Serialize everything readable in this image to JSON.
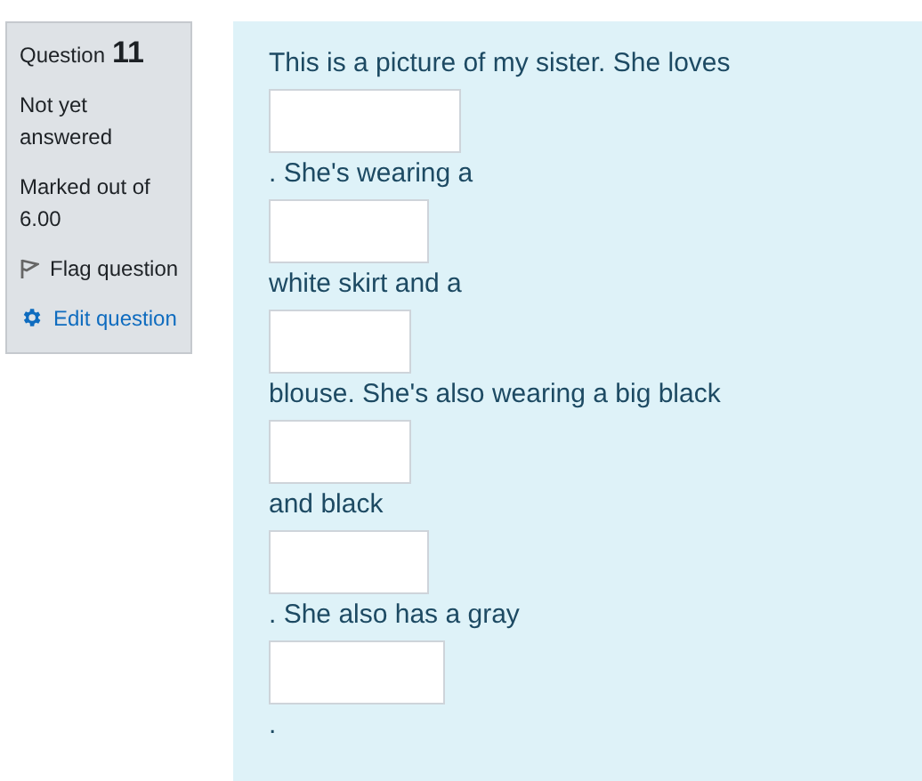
{
  "info": {
    "label": "Question",
    "number": "11",
    "status": "Not yet answered",
    "marks": "Marked out of 6.00",
    "flag": "Flag question",
    "edit": "Edit question"
  },
  "content": [
    {
      "kind": "text",
      "text": "This is a picture of my sister. She loves"
    },
    {
      "kind": "blank"
    },
    {
      "kind": "text",
      "text": ". She's wearing a"
    },
    {
      "kind": "blank"
    },
    {
      "kind": "text",
      "text": "white skirt and a"
    },
    {
      "kind": "blank"
    },
    {
      "kind": "text",
      "text": "blouse. She's also wearing a big black"
    },
    {
      "kind": "blank"
    },
    {
      "kind": "text",
      "text": "and black"
    },
    {
      "kind": "blank"
    },
    {
      "kind": "text",
      "text": ". She also has a gray"
    },
    {
      "kind": "blank"
    },
    {
      "kind": "text",
      "text": "."
    }
  ]
}
